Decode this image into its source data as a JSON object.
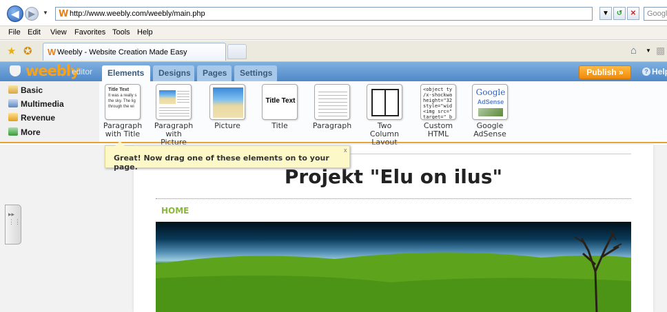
{
  "browser": {
    "url": "http://www.weebly.com/weebly/main.php",
    "search_placeholder": "Google",
    "tab_title": "Weebly - Website Creation Made Easy",
    "menu": [
      "File",
      "Edit",
      "View",
      "Favorites",
      "Tools",
      "Help"
    ]
  },
  "weebly": {
    "logo": "weebly",
    "logo_suffix": "editor",
    "tabs": [
      "Elements",
      "Designs",
      "Pages",
      "Settings"
    ],
    "active_tab": "Elements",
    "publish_label": "Publish »",
    "help_label": "Help",
    "categories": [
      "Basic",
      "Multimedia",
      "Revenue",
      "More"
    ],
    "elements": [
      {
        "label": "Paragraph with Title",
        "preview_title": "Title Text",
        "preview_text": "It was a really s the sky. The lig through the wi"
      },
      {
        "label": "Paragraph with Picture"
      },
      {
        "label": "Picture"
      },
      {
        "label": "Title",
        "preview_title": "Title Text"
      },
      {
        "label": "Paragraph"
      },
      {
        "label": "Two Column Layout"
      },
      {
        "label": "Custom HTML",
        "preview_code": "<object ty\n/x-shockwa\nheight=\"32\nstyle=\"wid\n<img src=\"\ntarget=\"_b"
      },
      {
        "label": "Google AdSense",
        "preview_brand": "Google",
        "preview_sub": "AdSense"
      }
    ],
    "tooltip": "Great! Now drag one of these elements on to your page.",
    "tooltip_close": "x"
  },
  "site": {
    "title": "Projekt \"Elu on ilus\"",
    "nav": [
      "HOME"
    ]
  },
  "colors": {
    "header_blue": "#4f88c8",
    "publish_orange": "#f08a0a",
    "logo_orange": "#f7a21c",
    "nav_green": "#8ab838",
    "tooltip_yellow": "#fcf8c8"
  }
}
